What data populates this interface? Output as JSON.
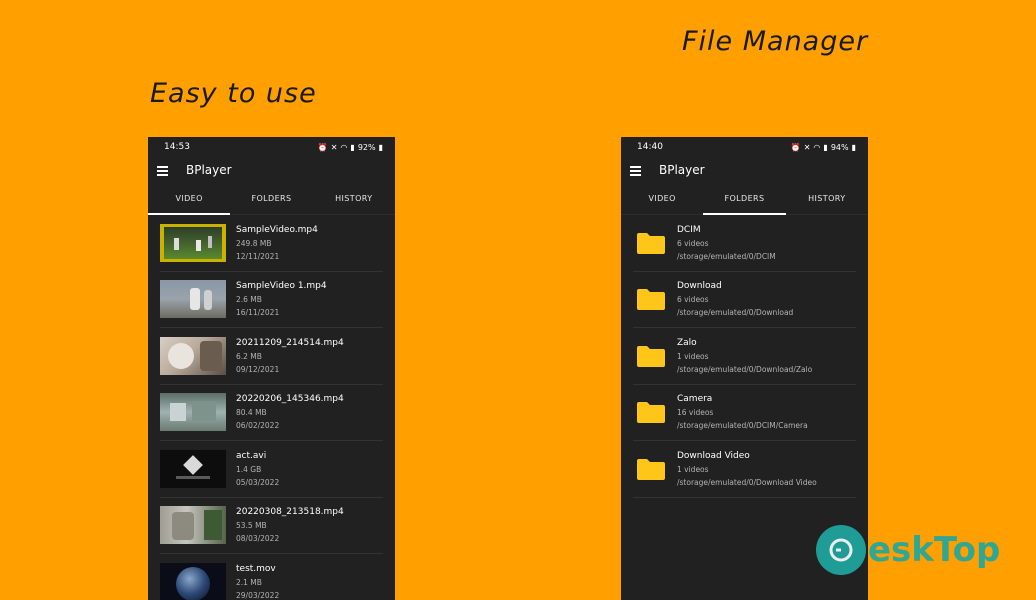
{
  "left": {
    "caption": "Easy to use",
    "phone": {
      "status_time": "14:53",
      "status_battery": "92%",
      "app_title": "BPlayer",
      "tabs": [
        {
          "label": "VIDEO",
          "active": true
        },
        {
          "label": "FOLDERS",
          "active": false
        },
        {
          "label": "HISTORY",
          "active": false
        }
      ],
      "videos": [
        {
          "name": "SampleVideo.mp4",
          "size": "249.8 MB",
          "date": "12/11/2021"
        },
        {
          "name": "SampleVideo 1.mp4",
          "size": "2.6 MB",
          "date": "16/11/2021"
        },
        {
          "name": "20211209_214514.mp4",
          "size": "6.2 MB",
          "date": "09/12/2021"
        },
        {
          "name": "20220206_145346.mp4",
          "size": "80.4 MB",
          "date": "06/02/2022"
        },
        {
          "name": "act.avi",
          "size": "1.4 GB",
          "date": "05/03/2022"
        },
        {
          "name": "20220308_213518.mp4",
          "size": "53.5 MB",
          "date": "08/03/2022"
        },
        {
          "name": "test.mov",
          "size": "2.1 MB",
          "date": "29/03/2022"
        }
      ]
    }
  },
  "right": {
    "caption": "File Manager",
    "phone": {
      "status_time": "14:40",
      "status_battery": "94%",
      "app_title": "BPlayer",
      "tabs": [
        {
          "label": "VIDEO",
          "active": false
        },
        {
          "label": "FOLDERS",
          "active": true
        },
        {
          "label": "HISTORY",
          "active": false
        }
      ],
      "folders": [
        {
          "name": "DCIM",
          "count": "6 videos",
          "path": "/storage/emulated/0/DCIM"
        },
        {
          "name": "Download",
          "count": "6 videos",
          "path": "/storage/emulated/0/Download"
        },
        {
          "name": "Zalo",
          "count": "1 videos",
          "path": "/storage/emulated/0/Download/Zalo"
        },
        {
          "name": "Camera",
          "count": "16 videos",
          "path": "/storage/emulated/0/DCIM/Camera"
        },
        {
          "name": "Download Video",
          "count": "1 videos",
          "path": "/storage/emulated/0/Download Video"
        }
      ]
    }
  },
  "watermark": {
    "text": "eskTop"
  },
  "colors": {
    "background": "#FF9F00",
    "phone_bg": "#212121",
    "folder": "#FFC61A",
    "watermark": "#1fa7a0"
  }
}
